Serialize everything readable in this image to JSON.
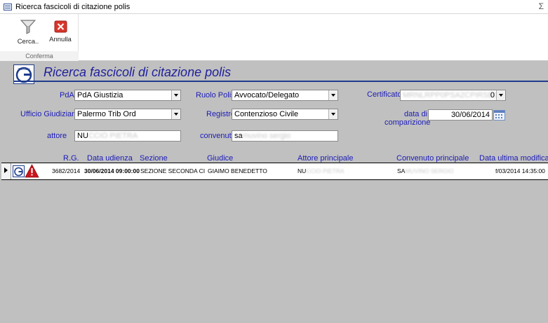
{
  "window": {
    "title": "Ricerca fascicoli di citazione polis",
    "corner_glyph": "Σ"
  },
  "ribbon": {
    "group_label": "Conferma",
    "search_label": "Cerca..",
    "cancel_label": "Annulla"
  },
  "form": {
    "title": "Ricerca fascicoli di citazione polis",
    "logo_text": "Giustizia"
  },
  "filters": {
    "pda": {
      "label": "PdA",
      "value": "PdA Giustizia"
    },
    "ruolo": {
      "label": "Ruolo Polis",
      "value": "Avvocato/Delegato"
    },
    "certificato": {
      "label": "Certificato",
      "value": "MRNLRPP0PSA2CPIRSE0",
      "value_end": "0"
    },
    "ufficio": {
      "label": "Ufficio Giudiziario",
      "value": "Palermo Trib Ord"
    },
    "registro": {
      "label": "Registro",
      "value": "Contenzioso Civile"
    },
    "data": {
      "label_line1": "data di",
      "label_line2": "comparizione",
      "value": "30/06/2014"
    },
    "attore": {
      "label": "attore",
      "value_visible": "NU",
      "value_hidden": "CCIO PIETRA"
    },
    "convenuto": {
      "label": "convenuto",
      "value_visible": "sa",
      "value_hidden": "muvino sergio"
    }
  },
  "table": {
    "headers": {
      "rg": "R.G.",
      "data_udienza": "Data udienza",
      "sezione": "Sezione",
      "giudice": "Giudice",
      "attore": "Attore principale",
      "convenuto": "Convenuto principale",
      "ultima_modifica": "Data ultima modifica"
    },
    "rows": [
      {
        "rg": "3682/2014",
        "data_udienza": "30/06/2014 09:00:00",
        "sezione": "SEZIONE SECONDA CIVIL",
        "giudice": "GIAIMO BENEDETTO",
        "attore_visible": "NU",
        "attore_hidden": "CCIO PIETRA",
        "convenuto_visible": "SA",
        "convenuto_hidden": "MUVINO SERGIO",
        "ultima_modifica": "f/03/2014 14:35:00"
      }
    ]
  },
  "colors": {
    "title_blue": "#1f1f9a",
    "label_blue": "#1b1bb8",
    "background": "#c0c0c0",
    "warning_red": "#c8161d"
  }
}
